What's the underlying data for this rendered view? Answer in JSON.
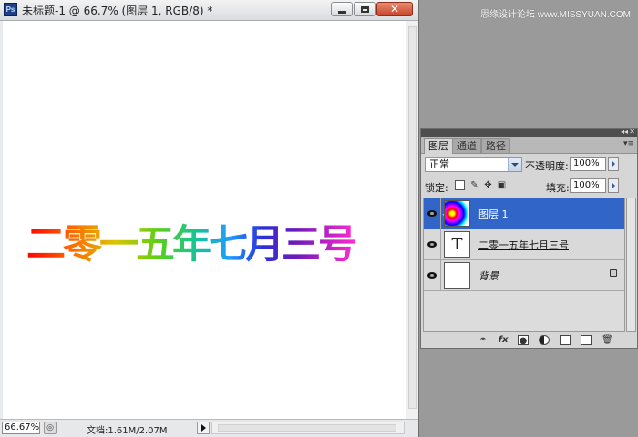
{
  "window": {
    "title": "未标题-1 @ 66.7% (图层 1, RGB/8) *",
    "app_icon": "Ps"
  },
  "canvas": {
    "text": "二零一五年七月三号"
  },
  "status_bar": {
    "zoom": "66.67%",
    "doc_info": "文档:1.61M/2.07M"
  },
  "layers_panel": {
    "tabs": [
      "图层",
      "通道",
      "路径"
    ],
    "blend_mode": "正常",
    "opacity_label": "不透明度:",
    "opacity_value": "100%",
    "lock_label": "锁定:",
    "fill_label": "填充:",
    "fill_value": "100%",
    "layers": [
      {
        "name": "图层 1",
        "selected": true
      },
      {
        "name": "二零一五年七月三号",
        "thumb": "T"
      },
      {
        "name": "背景",
        "locked": true
      }
    ],
    "toolbar_icons": [
      "link-icon",
      "fx-icon",
      "mask-icon",
      "adjustment-icon",
      "group-icon",
      "new-layer-icon",
      "trash-icon"
    ],
    "fx_label": "fx"
  },
  "watermark": "思缘设计论坛 www.MISSYUAN.COM"
}
